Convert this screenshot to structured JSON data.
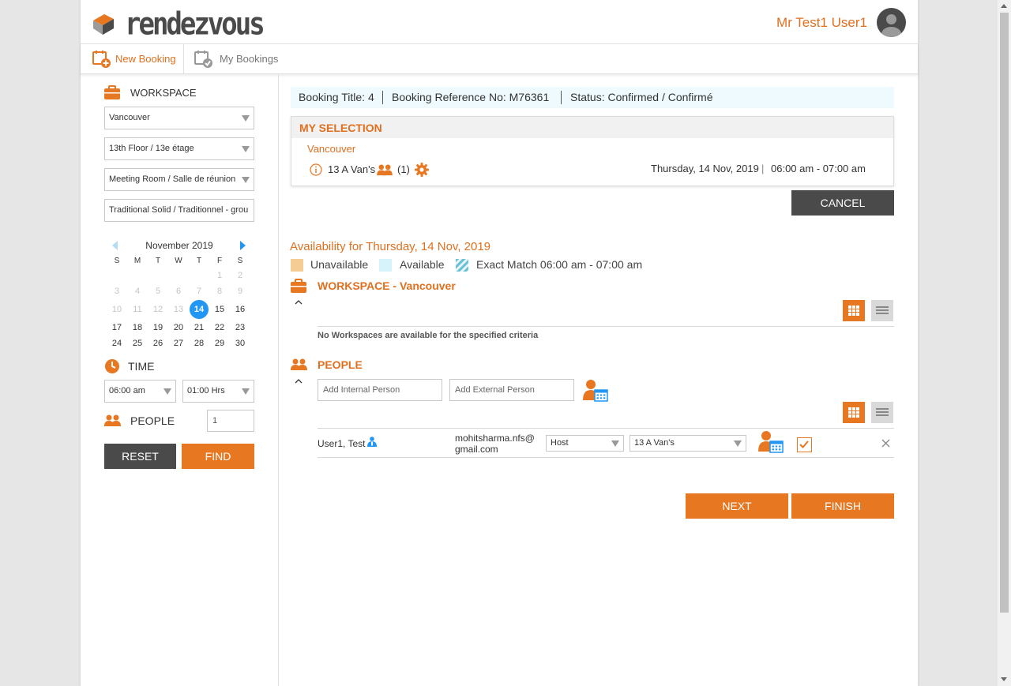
{
  "header": {
    "logo_text": "rendezvous",
    "user_name": "Mr Test1 User1"
  },
  "tabs": {
    "new_booking": "New Booking",
    "my_bookings": "My Bookings"
  },
  "sidebar": {
    "workspace_label": "WORKSPACE",
    "city": "Vancouver",
    "floor": "13th Floor / 13e étage",
    "room_type": "Meeting Room / Salle de réunion",
    "layout": "Traditional Solid / Traditionnel - grou",
    "calendar": {
      "month": "November 2019",
      "weekdays": [
        "S",
        "M",
        "T",
        "W",
        "T",
        "F",
        "S"
      ],
      "weeks": [
        [
          "",
          "",
          "",
          "",
          "",
          "1",
          "2"
        ],
        [
          "3",
          "4",
          "5",
          "6",
          "7",
          "8",
          "9"
        ],
        [
          "10",
          "11",
          "12",
          "13",
          "14",
          "15",
          "16"
        ],
        [
          "17",
          "18",
          "19",
          "20",
          "21",
          "22",
          "23"
        ],
        [
          "24",
          "25",
          "26",
          "27",
          "28",
          "29",
          "30"
        ]
      ],
      "selected_day": "14"
    },
    "time_label": "TIME",
    "start_time": "06:00 am",
    "duration": "01:00 Hrs",
    "people_label": "PEOPLE",
    "people_count": "1",
    "reset_label": "RESET",
    "find_label": "FIND"
  },
  "booking_info": {
    "title": "Booking Title: 4",
    "reference": "Booking Reference No: M76361",
    "status": "Status: Confirmed / Confirmé"
  },
  "my_selection": {
    "heading": "MY SELECTION",
    "city": "Vancouver",
    "room": "13 A Van's",
    "people": "(1)",
    "date": "Thursday, 14 Nov, 2019",
    "separator": "|",
    "time": "06:00 am - 07:00 am",
    "cancel_label": "CANCEL"
  },
  "availability": {
    "heading": "Availability for Thursday, 14 Nov, 2019",
    "legend_unavailable": "Unavailable",
    "legend_available": "Available",
    "legend_exact": "Exact Match 06:00 am - 07:00 am"
  },
  "workspace_section": {
    "title": "WORKSPACE - Vancouver",
    "empty_message": "No Workspaces are available for the specified criteria"
  },
  "people_section": {
    "title": "PEOPLE",
    "internal_placeholder": "Add Internal Person",
    "external_placeholder": "Add External Person",
    "person": {
      "name": "User1, Test",
      "email_line1": "mohitsharma.nfs@",
      "email_line2": "gmail.com",
      "role": "Host",
      "room": "13 A Van's"
    }
  },
  "actions": {
    "next_label": "NEXT",
    "finish_label": "FINISH"
  },
  "colors": {
    "accent": "#e87722",
    "dark_button": "#4a4a4a",
    "selected_day": "#2196f3",
    "unavailable": "#f5cd94",
    "available": "#d6f2fa",
    "info_bar": "#eefafd"
  }
}
